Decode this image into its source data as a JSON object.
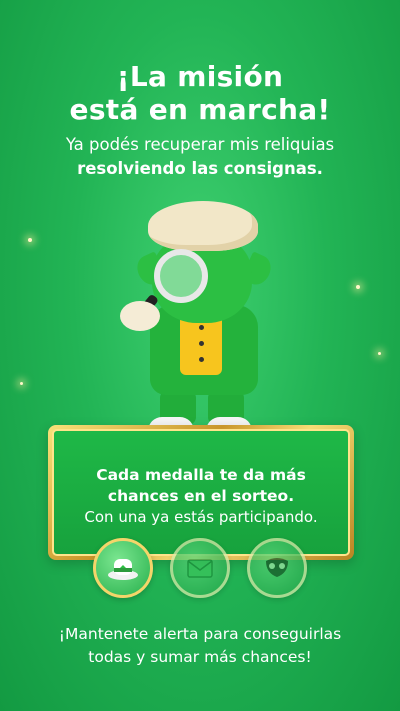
{
  "header": {
    "title_line1": "¡La misión",
    "title_line2": "está en marcha!",
    "subtitle_line1": "Ya podés recuperar mis reliquias",
    "subtitle_line2": "resolviendo las consignas."
  },
  "panel": {
    "line1": "Cada medalla te da más",
    "line2": "chances en el sorteo.",
    "line3": "Con una ya estás participando."
  },
  "medals": [
    {
      "name": "hat-medal-icon",
      "state": "obtained"
    },
    {
      "name": "envelope-medal-icon",
      "state": "locked"
    },
    {
      "name": "mask-medal-icon",
      "state": "locked"
    }
  ],
  "footer": {
    "line1": "¡Mantenete alerta para conseguirlas",
    "line2": "todas y sumar más chances!"
  },
  "colors": {
    "background": "#22b455",
    "gold_frame": "#d9aa3a",
    "panel_green": "#1cae44"
  }
}
